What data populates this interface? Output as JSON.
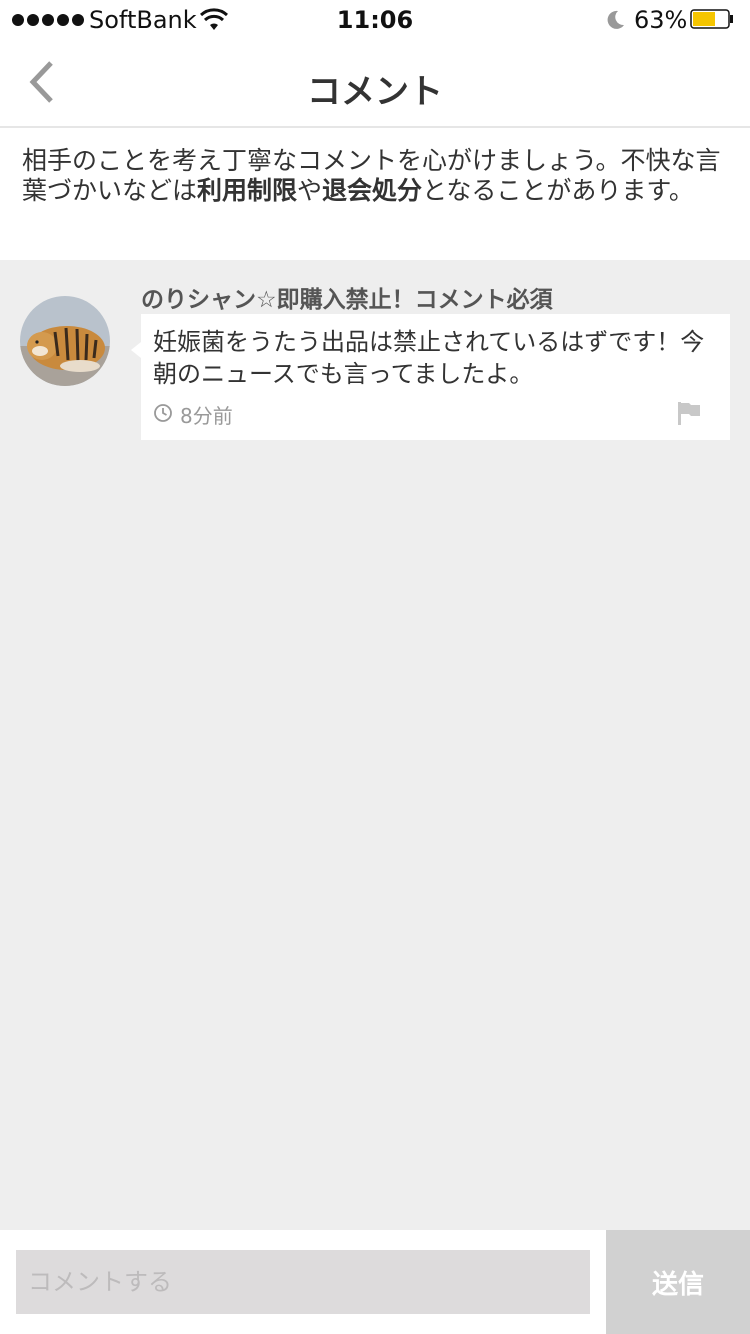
{
  "status_bar": {
    "carrier": "SoftBank",
    "time": "11:06",
    "battery_percent": "63%"
  },
  "nav": {
    "title": "コメント"
  },
  "notice": {
    "text_before": "相手のことを考え丁寧なコメントを心がけましょう。不快な言葉づかいなどは",
    "bold_1": "利用制限",
    "mid": "や",
    "bold_2": "退会処分",
    "text_after": "となることがあります。"
  },
  "comments": [
    {
      "user": "のりシャン☆即購入禁止！コメント必須",
      "text": "妊娠菌をうたう出品は禁止されているはずです！今朝のニュースでも言ってましたよ。",
      "time": "8分前"
    }
  ],
  "input": {
    "placeholder": "コメントする",
    "send_label": "送信"
  },
  "colors": {
    "background": "#eeeeee",
    "battery": "#f5c500",
    "send_button": "#d1d1d1"
  }
}
